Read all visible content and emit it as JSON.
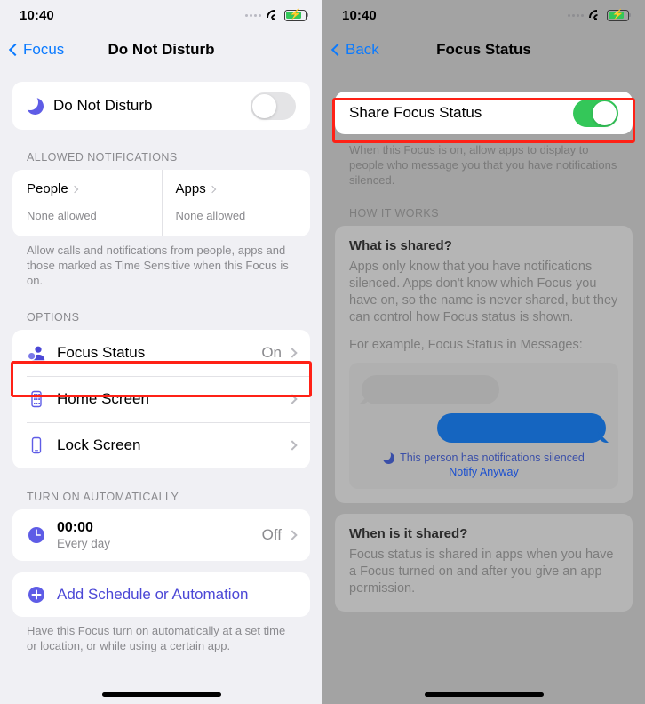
{
  "left": {
    "status_bar": {
      "time": "10:40",
      "wifi_icon": "wifi-icon",
      "battery_icon": "battery-charging-icon",
      "signal_icon": "signal-dots-icon"
    },
    "nav": {
      "back_label": "Focus",
      "title": "Do Not Disturb",
      "back_icon": "chevron-left-icon"
    },
    "dnd_row": {
      "icon": "moon-icon",
      "label": "Do Not Disturb",
      "toggle_state": "off"
    },
    "allowed_section": {
      "header": "ALLOWED NOTIFICATIONS",
      "cells": [
        {
          "title": "People",
          "subtitle": "None allowed",
          "chevron_icon": "chevron-right-icon"
        },
        {
          "title": "Apps",
          "subtitle": "None allowed",
          "chevron_icon": "chevron-right-icon"
        }
      ],
      "footnote": "Allow calls and notifications from people, apps and those marked as Time Sensitive when this Focus is on."
    },
    "options_section": {
      "header": "OPTIONS",
      "rows": [
        {
          "icon": "focus-status-person-icon",
          "label": "Focus Status",
          "value": "On",
          "chevron_icon": "chevron-right-icon",
          "highlighted": true
        },
        {
          "icon": "home-screen-phone-icon",
          "label": "Home Screen",
          "value": "",
          "chevron_icon": "chevron-right-icon",
          "highlighted": false
        },
        {
          "icon": "lock-screen-phone-icon",
          "label": "Lock Screen",
          "value": "",
          "chevron_icon": "chevron-right-icon",
          "highlighted": false
        }
      ]
    },
    "automation_section": {
      "header": "TURN ON AUTOMATICALLY",
      "schedule": {
        "icon": "clock-icon",
        "time": "00:00",
        "repeat": "Every day",
        "value": "Off",
        "chevron_icon": "chevron-right-icon"
      },
      "add_label": "Add Schedule or Automation",
      "add_icon": "plus-circle-icon",
      "footnote": "Have this Focus turn on automatically at a set time or location, or while using a certain app."
    }
  },
  "right": {
    "status_bar": {
      "time": "10:40",
      "wifi_icon": "wifi-icon",
      "battery_icon": "battery-charging-icon",
      "signal_icon": "signal-dots-icon"
    },
    "nav": {
      "back_label": "Back",
      "title": "Focus Status",
      "back_icon": "chevron-left-icon"
    },
    "share_row": {
      "label": "Share Focus Status",
      "toggle_state": "on",
      "highlighted": true
    },
    "share_footnote": "When this Focus is on, allow apps to display to people who message you that you have notifications silenced.",
    "how_header": "HOW IT WORKS",
    "what_shared": {
      "heading": "What is shared?",
      "paragraph": "Apps only know that you have notifications silenced. Apps don't know which Focus you have on, so the name is never shared, but they can control how Focus status is shown.",
      "example_intro": "For example, Focus Status in Messages:",
      "mock": {
        "moon_icon": "moon-icon",
        "note": "This person has notifications silenced",
        "link": "Notify Anyway"
      }
    },
    "when_shared": {
      "heading": "When is it shared?",
      "paragraph": "Focus status is shared in apps when you have a Focus turned on and after you give an app permission."
    }
  },
  "colors": {
    "accent_purple": "#5e5ce6",
    "link_blue": "#0a7aff",
    "toggle_on_green": "#34c759",
    "highlight_red": "#ff2116",
    "bubble_blue": "#1565c0"
  }
}
